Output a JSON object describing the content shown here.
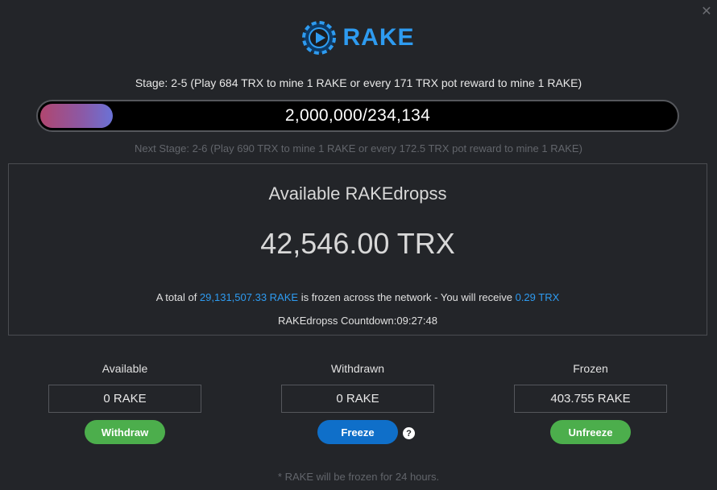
{
  "header": {
    "logo_text": "RAKE",
    "close_icon": "close-icon"
  },
  "stage": {
    "current": "Stage: 2-5 (Play 684 TRX to mine 1 RAKE or every 171 TRX pot reward to mine 1 RAKE)",
    "progress_text": "2,000,000/234,134",
    "progress_fraction": 0.117,
    "next": "Next Stage: 2-6 (Play 690 TRX to mine 1 RAKE or every 172.5 TRX pot reward to mine 1 RAKE)"
  },
  "drops": {
    "title": "Available RAKEdropss",
    "amount": "42,546.00 TRX",
    "total_prefix": "A total of ",
    "total_frozen": "29,131,507.33 RAKE",
    "total_middle": " is frozen across the network - You will receive ",
    "receive_amount": "0.29 TRX",
    "countdown": "RAKEdropss Countdown:09:27:48"
  },
  "columns": {
    "available": {
      "label": "Available",
      "value": "0 RAKE",
      "button": "Withdraw"
    },
    "withdrawn": {
      "label": "Withdrawn",
      "value": "0 RAKE",
      "button": "Freeze"
    },
    "frozen": {
      "label": "Frozen",
      "value": "403.755 RAKE",
      "button": "Unfreeze"
    }
  },
  "help_icon_text": "?",
  "footnote": "* RAKE will be frozen for 24 hours.",
  "colors": {
    "background": "#232529",
    "accent_blue": "#2e9bf0",
    "green_button": "#4cae4c",
    "blue_button": "#0f6fc9"
  }
}
